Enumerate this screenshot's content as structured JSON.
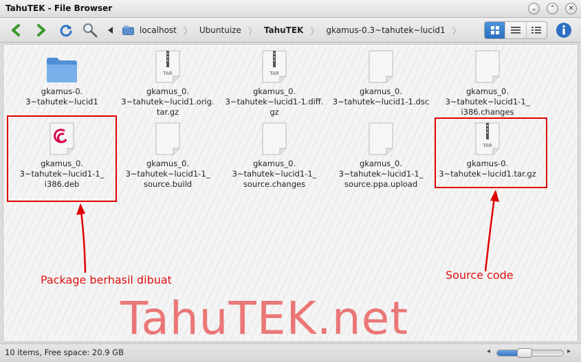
{
  "window": {
    "title": "TahuTEK - File Browser"
  },
  "titlebar_buttons": [
    {
      "glyph": "⌄",
      "icon": "minimize-icon"
    },
    {
      "glyph": "⌃",
      "icon": "maximize-icon"
    },
    {
      "glyph": "✕",
      "icon": "close-icon"
    }
  ],
  "breadcrumb": [
    {
      "label": "localhost",
      "icon": "drive-icon",
      "current": false
    },
    {
      "label": "Ubuntuize",
      "current": false
    },
    {
      "label": "TahuTEK",
      "current": true
    },
    {
      "label": "gkamus-0.3~tahutek~lucid1",
      "current": false
    }
  ],
  "files": [
    {
      "label": "gkamus-0. 3~tahutek~lucid1",
      "type": "folder"
    },
    {
      "label": "gkamus_0. 3~tahutek~lucid1.orig. tar.gz",
      "type": "tar"
    },
    {
      "label": "gkamus_0. 3~tahutek~lucid1-1.diff. gz",
      "type": "tar"
    },
    {
      "label": "gkamus_0. 3~tahutek~lucid1-1.dsc",
      "type": "file"
    },
    {
      "label": "gkamus_0. 3~tahutek~lucid1-1_ i386.changes",
      "type": "file"
    },
    {
      "label": "gkamus_0. 3~tahutek~lucid1-1_ i386.deb",
      "type": "deb"
    },
    {
      "label": "gkamus_0. 3~tahutek~lucid1-1_ source.build",
      "type": "file"
    },
    {
      "label": "gkamus_0. 3~tahutek~lucid1-1_ source.changes",
      "type": "file"
    },
    {
      "label": "gkamus_0. 3~tahutek~lucid1-1_ source.ppa.upload",
      "type": "file"
    },
    {
      "label": "gkamus-0. 3~tahutek~lucid1.tar.gz",
      "type": "tar"
    }
  ],
  "tar_badge": "TAR",
  "annotations": {
    "left": "Package berhasil dibuat",
    "right": "Source code"
  },
  "watermark": "TahuTEK.net",
  "status": {
    "text": "10 items, Free space: 20.9 GB",
    "zoom_fraction": 0.42
  },
  "colors": {
    "accent": "#2a6fbf",
    "annotation": "#e00000",
    "watermark": "#e84646",
    "deb_swirl": "#d70a53"
  }
}
